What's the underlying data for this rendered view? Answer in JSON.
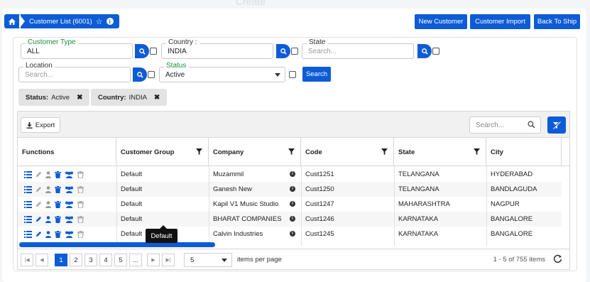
{
  "page": {
    "ghost_title": "Create"
  },
  "breadcrumb": {
    "title": "Customer List (6001)"
  },
  "header_buttons": {
    "new_customer": "New Customer",
    "customer_import": "Customer Import",
    "back_to_ship": "Back To Ship"
  },
  "filters": {
    "customer_type": {
      "label": "Customer Type",
      "value": "ALL"
    },
    "country": {
      "label": "Country :",
      "value": "INDIA"
    },
    "state": {
      "label": "State",
      "placeholder": "Search..."
    },
    "location": {
      "label": "Location",
      "placeholder": "Search..."
    },
    "status": {
      "label": "Status",
      "value": "Active"
    },
    "search_button": "Search"
  },
  "chips": [
    {
      "key": "Status:",
      "value": "Active"
    },
    {
      "key": "Country:",
      "value": "INDIA"
    }
  ],
  "grid": {
    "export_label": "Export",
    "search_placeholder": "Search...",
    "columns": [
      "Functions",
      "Customer Group",
      "Company",
      "Code",
      "State",
      "City"
    ],
    "rows": [
      {
        "group": "Default",
        "company": "Muzammil",
        "code": "Cust1251",
        "state": "TELANGANA",
        "city": "HYDERABAD"
      },
      {
        "group": "Default",
        "company": "Ganesh New",
        "code": "Cust1250",
        "state": "TELANGANA",
        "city": "BANDLAGUDA"
      },
      {
        "group": "Default",
        "company": "Kapil V1 Music Studio",
        "code": "Cust1247",
        "state": "MAHARASHTRA",
        "city": "NAGPUR"
      },
      {
        "group": "Default",
        "company": "BHARAT COMPANIES",
        "code": "Cust1246",
        "state": "KARNATAKA",
        "city": "BANGALORE"
      },
      {
        "group": "Default",
        "company": "Calvin Industries",
        "code": "Cust1245",
        "state": "KARNATAKA",
        "city": "BANGALORE"
      }
    ],
    "tooltip": "Default"
  },
  "pager": {
    "pages": [
      "1",
      "2",
      "3",
      "4",
      "5",
      "..."
    ],
    "page_size": "5",
    "items_per_page": "items per page",
    "info": "1 - 5 of 755 items"
  },
  "colors": {
    "primary": "#0d5cd6",
    "green_label": "#1a8f3a"
  }
}
